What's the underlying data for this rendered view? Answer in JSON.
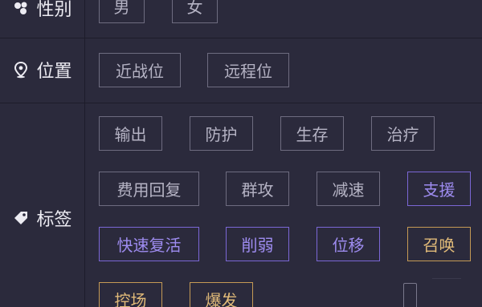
{
  "filters": {
    "gender": {
      "label": "性别",
      "icon": "gender-icon",
      "options": [
        "男",
        "女"
      ]
    },
    "position": {
      "label": "位置",
      "icon": "location-pin-icon",
      "options": [
        "近战位",
        "远程位"
      ]
    },
    "tags": {
      "label": "标签",
      "icon": "tag-icon",
      "options": [
        {
          "text": "输出",
          "style": "default"
        },
        {
          "text": "防护",
          "style": "default"
        },
        {
          "text": "生存",
          "style": "default"
        },
        {
          "text": "治疗",
          "style": "default"
        },
        {
          "text": "费用回复",
          "style": "default"
        },
        {
          "text": "群攻",
          "style": "default"
        },
        {
          "text": "减速",
          "style": "default"
        },
        {
          "text": "支援",
          "style": "purple"
        },
        {
          "text": "快速复活",
          "style": "purple"
        },
        {
          "text": "削弱",
          "style": "purple"
        },
        {
          "text": "位移",
          "style": "purple"
        },
        {
          "text": "召唤",
          "style": "gold"
        },
        {
          "text": "控场",
          "style": "gold"
        },
        {
          "text": "爆发",
          "style": "gold"
        }
      ]
    }
  },
  "colors": {
    "background": "#2b2a3c",
    "chip_border": "#6e6c80",
    "chip_text": "#b5b3c4",
    "purple_accent": "#7b67d6",
    "gold_accent": "#c59a55"
  }
}
